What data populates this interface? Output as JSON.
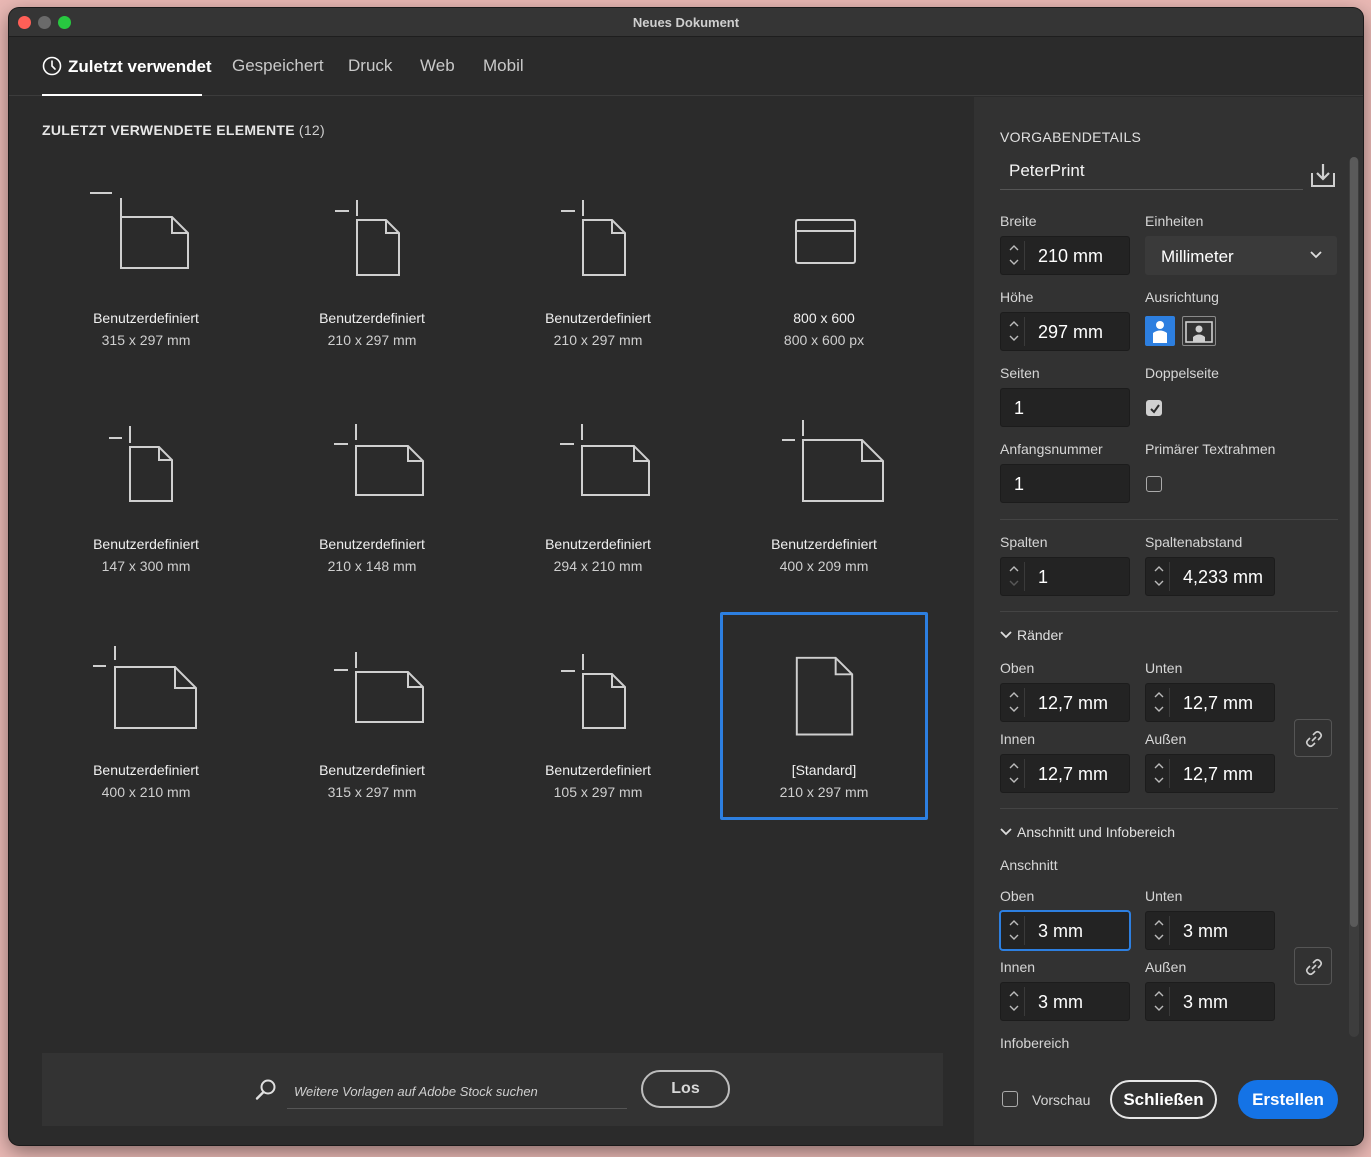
{
  "window": {
    "title": "Neues Dokument"
  },
  "tabs": [
    {
      "label": "Zuletzt verwendet",
      "active": true
    },
    {
      "label": "Gespeichert"
    },
    {
      "label": "Druck"
    },
    {
      "label": "Web"
    },
    {
      "label": "Mobil"
    }
  ],
  "recent": {
    "title": "ZULETZT VERWENDETE ELEMENTE",
    "count": "(12)",
    "items": [
      {
        "name": "Benutzerdefiniert",
        "size": "315 x 297 mm",
        "icon": "landscape-document-icon"
      },
      {
        "name": "Benutzerdefiniert",
        "size": "210 x 297 mm",
        "icon": "portrait-document-icon"
      },
      {
        "name": "Benutzerdefiniert",
        "size": "210 x 297 mm",
        "icon": "portrait-document-icon"
      },
      {
        "name": "800 x 600",
        "size": "800 x 600 px",
        "icon": "web-window-icon"
      },
      {
        "name": "Benutzerdefiniert",
        "size": "147 x 300 mm",
        "icon": "portrait-document-icon"
      },
      {
        "name": "Benutzerdefiniert",
        "size": "210 x 148 mm",
        "icon": "landscape-document-icon"
      },
      {
        "name": "Benutzerdefiniert",
        "size": "294 x 210 mm",
        "icon": "landscape-document-icon"
      },
      {
        "name": "Benutzerdefiniert",
        "size": "400 x 209 mm",
        "icon": "landscape-document-icon"
      },
      {
        "name": "Benutzerdefiniert",
        "size": "400 x 210 mm",
        "icon": "landscape-document-icon"
      },
      {
        "name": "Benutzerdefiniert",
        "size": "315 x 297 mm",
        "icon": "landscape-document-icon"
      },
      {
        "name": "Benutzerdefiniert",
        "size": "105 x 297 mm",
        "icon": "portrait-document-icon"
      },
      {
        "name": "[Standard]",
        "size": "210 x 297 mm",
        "icon": "portrait-document-icon",
        "selected": true
      }
    ]
  },
  "search": {
    "placeholder": "Weitere Vorlagen auf Adobe Stock suchen",
    "button": "Los"
  },
  "details": {
    "header": "VORGABENDETAILS",
    "preset_name": "PeterPrint",
    "width_label": "Breite",
    "width": "210 mm",
    "units_label": "Einheiten",
    "units": "Millimeter",
    "height_label": "Höhe",
    "height": "297 mm",
    "orientation_label": "Ausrichtung",
    "orientation": "portrait",
    "pages_label": "Seiten",
    "pages": "1",
    "facing_label": "Doppelseite",
    "facing_checked": true,
    "start_label": "Anfangsnummer",
    "start": "1",
    "primary_frame_label": "Primärer Textrahmen",
    "primary_frame_checked": false,
    "columns_label": "Spalten",
    "columns": "1",
    "gutter_label": "Spaltenabstand",
    "gutter": "4,233 mm",
    "margins": {
      "title": "Ränder",
      "top_label": "Oben",
      "top": "12,7 mm",
      "bottom_label": "Unten",
      "bottom": "12,7 mm",
      "inside_label": "Innen",
      "inside": "12,7 mm",
      "outside_label": "Außen",
      "outside": "12,7 mm"
    },
    "bleed": {
      "title": "Anschnitt und Infobereich",
      "subtitle": "Anschnitt",
      "top_label": "Oben",
      "top": "3 mm",
      "bottom_label": "Unten",
      "bottom": "3 mm",
      "inside_label": "Innen",
      "inside": "3 mm",
      "outside_label": "Außen",
      "outside": "3 mm",
      "slug_label": "Infobereich"
    },
    "preview_label": "Vorschau",
    "preview_checked": false,
    "close_button": "Schließen",
    "create_button": "Erstellen"
  },
  "colors": {
    "accent": "#1473e6",
    "selection": "#2d7fe0",
    "panel": "#2b2b2b",
    "sidebar": "#323232"
  }
}
